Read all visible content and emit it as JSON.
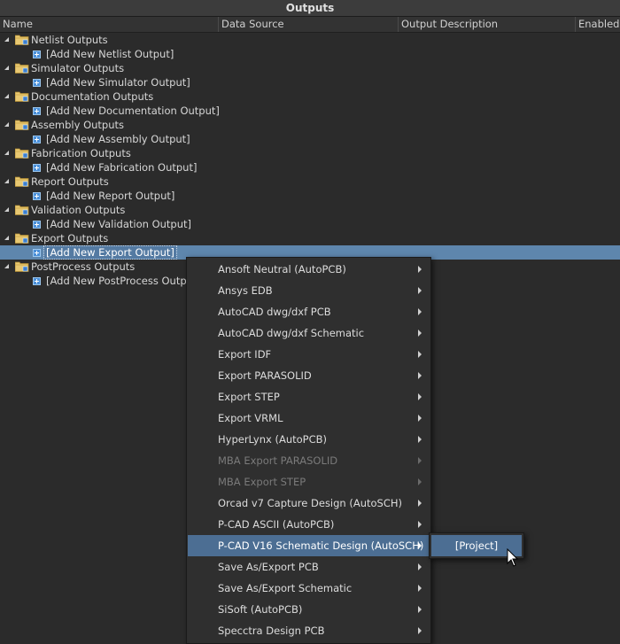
{
  "panel": {
    "title": "Outputs"
  },
  "columns": [
    "Name",
    "Data Source",
    "Output Description",
    "Enabled"
  ],
  "groups": [
    {
      "label": "Netlist Outputs",
      "add": "[Add New Netlist Output]"
    },
    {
      "label": "Simulator Outputs",
      "add": "[Add New Simulator Output]"
    },
    {
      "label": "Documentation Outputs",
      "add": "[Add New Documentation Output]"
    },
    {
      "label": "Assembly Outputs",
      "add": "[Add New Assembly Output]"
    },
    {
      "label": "Fabrication Outputs",
      "add": "[Add New Fabrication Output]"
    },
    {
      "label": "Report Outputs",
      "add": "[Add New Report Output]"
    },
    {
      "label": "Validation Outputs",
      "add": "[Add New Validation Output]"
    },
    {
      "label": "Export Outputs",
      "add": "[Add New Export Output]"
    },
    {
      "label": "PostProcess Outputs",
      "add": "[Add New PostProcess Output]"
    }
  ],
  "selected_group_index": 7,
  "context_menu": [
    {
      "label": "Ansoft Neutral (AutoPCB)",
      "enabled": true
    },
    {
      "label": "Ansys EDB",
      "enabled": true
    },
    {
      "label": "AutoCAD dwg/dxf PCB",
      "enabled": true
    },
    {
      "label": "AutoCAD dwg/dxf Schematic",
      "enabled": true
    },
    {
      "label": "Export IDF",
      "enabled": true
    },
    {
      "label": "Export PARASOLID",
      "enabled": true
    },
    {
      "label": "Export STEP",
      "enabled": true
    },
    {
      "label": "Export VRML",
      "enabled": true
    },
    {
      "label": "HyperLynx (AutoPCB)",
      "enabled": true
    },
    {
      "label": "MBA Export PARASOLID",
      "enabled": false
    },
    {
      "label": "MBA Export STEP",
      "enabled": false
    },
    {
      "label": "Orcad v7 Capture Design (AutoSCH)",
      "enabled": true
    },
    {
      "label": "P-CAD ASCII (AutoPCB)",
      "enabled": true
    },
    {
      "label": "P-CAD V16 Schematic Design (AutoSCH)",
      "enabled": true,
      "highlighted": true
    },
    {
      "label": "Save As/Export PCB",
      "enabled": true
    },
    {
      "label": "Save As/Export Schematic",
      "enabled": true
    },
    {
      "label": "SiSoft (AutoPCB)",
      "enabled": true
    },
    {
      "label": "Specctra Design PCB",
      "enabled": true
    }
  ],
  "submenu": {
    "label": "[Project]"
  },
  "colors": {
    "accent": "#5e86ad",
    "menu_highlight": "#4c6e93",
    "background": "#2b2b2b"
  }
}
